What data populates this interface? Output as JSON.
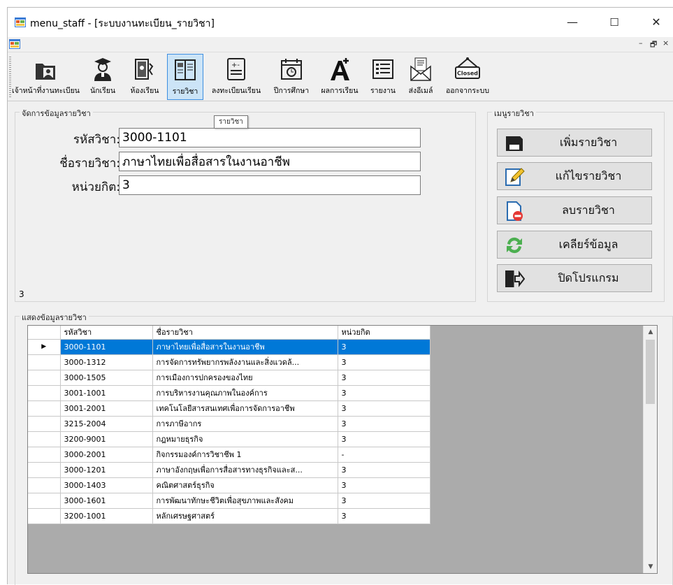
{
  "window": {
    "title": "menu_staff - [ระบบงานทะเบียน_รายวิชา]",
    "controls": {
      "minimize": "—",
      "maximize": "☐",
      "close": "✕"
    },
    "mdi_controls": {
      "minimize": "–",
      "restore": "🗗",
      "close": "×"
    }
  },
  "toolbar": {
    "items": [
      {
        "label": "เจ้าหน้าที่งานทะเบียน",
        "icon": "staff-icon"
      },
      {
        "label": "นักเรียน",
        "icon": "student-icon"
      },
      {
        "label": "ห้องเรียน",
        "icon": "classroom-icon"
      },
      {
        "label": "รายวิชา",
        "icon": "book-icon"
      },
      {
        "label": "ลงทะเบียนเรียน",
        "icon": "register-icon"
      },
      {
        "label": "ปีการศึกษา",
        "icon": "calendar-icon"
      },
      {
        "label": "ผลการเรียน",
        "icon": "grade-icon"
      },
      {
        "label": "รายงาน",
        "icon": "report-icon"
      },
      {
        "label": "ส่งอีเมล์",
        "icon": "mail-icon"
      },
      {
        "label": "ออกจากระบบ",
        "icon": "closed-sign-icon"
      }
    ],
    "closed_text": "Closed"
  },
  "tooltip": "รายวิชา",
  "form": {
    "group_title": "จัดการข้อมูลรายวิชา",
    "code_label": "รหัสวิชา:",
    "code_value": "3000-1101",
    "name_label": "ชื่อรายวิชา:",
    "name_value": "ภาษาไทยเพื่อสื่อสารในงานอาชีพ",
    "credit_label": "หน่วยกิต:",
    "credit_value": "3"
  },
  "menu": {
    "group_title": "เมนูรายวิชา",
    "add": "เพิ่มรายวิชา",
    "edit": "แก้ไขรายวิชา",
    "delete": "ลบรายวิชา",
    "clear": "เคลียร์ข้อมูล",
    "exit": "ปิดโปรแกรม"
  },
  "status_value": "3",
  "grid": {
    "group_title": "แสดงข้อมูลรายวิชา",
    "columns": [
      "รหัสวิชา",
      "ชื่อรายวิชา",
      "หน่วยกิต"
    ],
    "row_indicator": "▶",
    "rows": [
      [
        "3000-1101",
        "ภาษาไทยเพื่อสื่อสารในงานอาชีพ",
        "3"
      ],
      [
        "3000-1312",
        "การจัดการทรัพยากรพลังงานและสิ่งแวดล้...",
        "3"
      ],
      [
        "3000-1505",
        "การเมืองการปกครองของไทย",
        "3"
      ],
      [
        "3001-1001",
        "การบริหารงานคุณภาพในองค์การ",
        "3"
      ],
      [
        "3001-2001",
        "เทคโนโลยีสารสนเทศเพื่อการจัดการอาชีพ",
        "3"
      ],
      [
        "3215-2004",
        "การภาษีอากร",
        "3"
      ],
      [
        "3200-9001",
        "กฎหมายธุรกิจ",
        "3"
      ],
      [
        "3000-2001",
        "กิจกรรมองค์การวิชาชีพ 1",
        "-"
      ],
      [
        "3000-1201",
        "ภาษาอังกฤษเพื่อการสื่อสารทางธุรกิจและส...",
        "3"
      ],
      [
        "3000-1403",
        "คณิตศาสตร์ธุรกิจ",
        "3"
      ],
      [
        "3000-1601",
        "การพัฒนาทักษะชีวิตเพื่อสุขภาพและสังคม",
        "3"
      ],
      [
        "3200-1001",
        "หลักเศรษฐศาสตร์",
        "3"
      ]
    ]
  }
}
